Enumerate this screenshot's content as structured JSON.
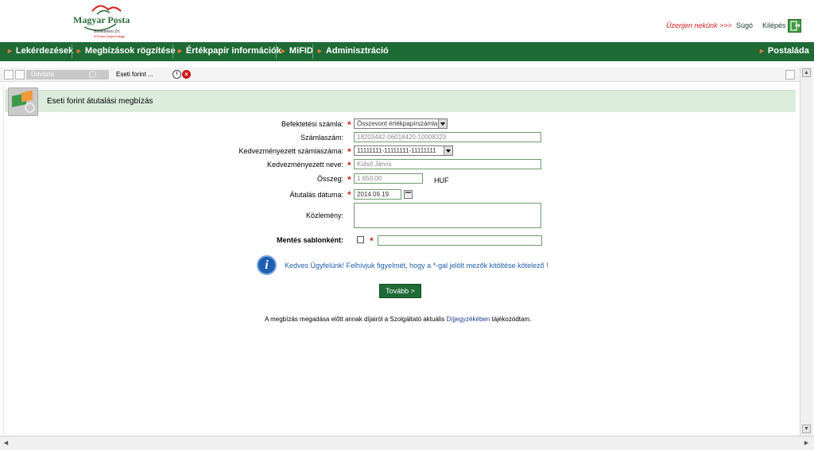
{
  "header": {
    "logo_name": "Magyar Posta",
    "logo_sub": "Befektetési Zrt.",
    "logo_sub2": "A Posta Csoport tagja",
    "message_link": "Üzenjen nekünk >>>",
    "help_link": "Súgó",
    "exit_link": "Kilépés"
  },
  "nav": {
    "items": [
      {
        "label": "Lekérdezések"
      },
      {
        "label": "Megbízások rögzítése"
      },
      {
        "label": "Értékpapír információk"
      },
      {
        "label": "MiFID"
      },
      {
        "label": "Adminisztráció"
      }
    ],
    "right_label": "Postaláda"
  },
  "tabs": {
    "inactive_label": "Üdvözlő",
    "active_label": "Eseti forint ...",
    "close_glyph": "×"
  },
  "panel": {
    "title": "Eseti forint átutalási megbízás"
  },
  "form": {
    "account_label": "Befektetési számla:",
    "account_value": "Összevont értékpapírszámla",
    "account_number_label": "Számlaszám:",
    "account_number_value": "18203442-06018420-10008323",
    "beneficiary_account_label": "Kedvezményezett számlaszáma:",
    "beneficiary_account_value": "11111111-11111111-11111111",
    "beneficiary_name_label": "Kedvezményezett neve:",
    "beneficiary_name_value": "Külső János",
    "amount_label": "Összeg:",
    "amount_value": "1 650,00",
    "currency": "HUF",
    "date_label": "Átutalás dátuma:",
    "date_value": "2014.09.19",
    "note_label": "Közlemény:",
    "save_template_label": "Mentés sablonként:",
    "required_mark": "*"
  },
  "info": {
    "icon_glyph": "i",
    "text": "Kedves Ügyfelünk! Felhívjuk figyelmét, hogy a *-gal jelölt mezők kitöltése kötelező !"
  },
  "actions": {
    "next_label": "Tovább >"
  },
  "footer": {
    "note_before": "A megbízás megadása előtt annak díjairól a Szolgáltató aktuális ",
    "note_link": "Díjjegyzékében",
    "note_after": " tájékozódtam."
  }
}
